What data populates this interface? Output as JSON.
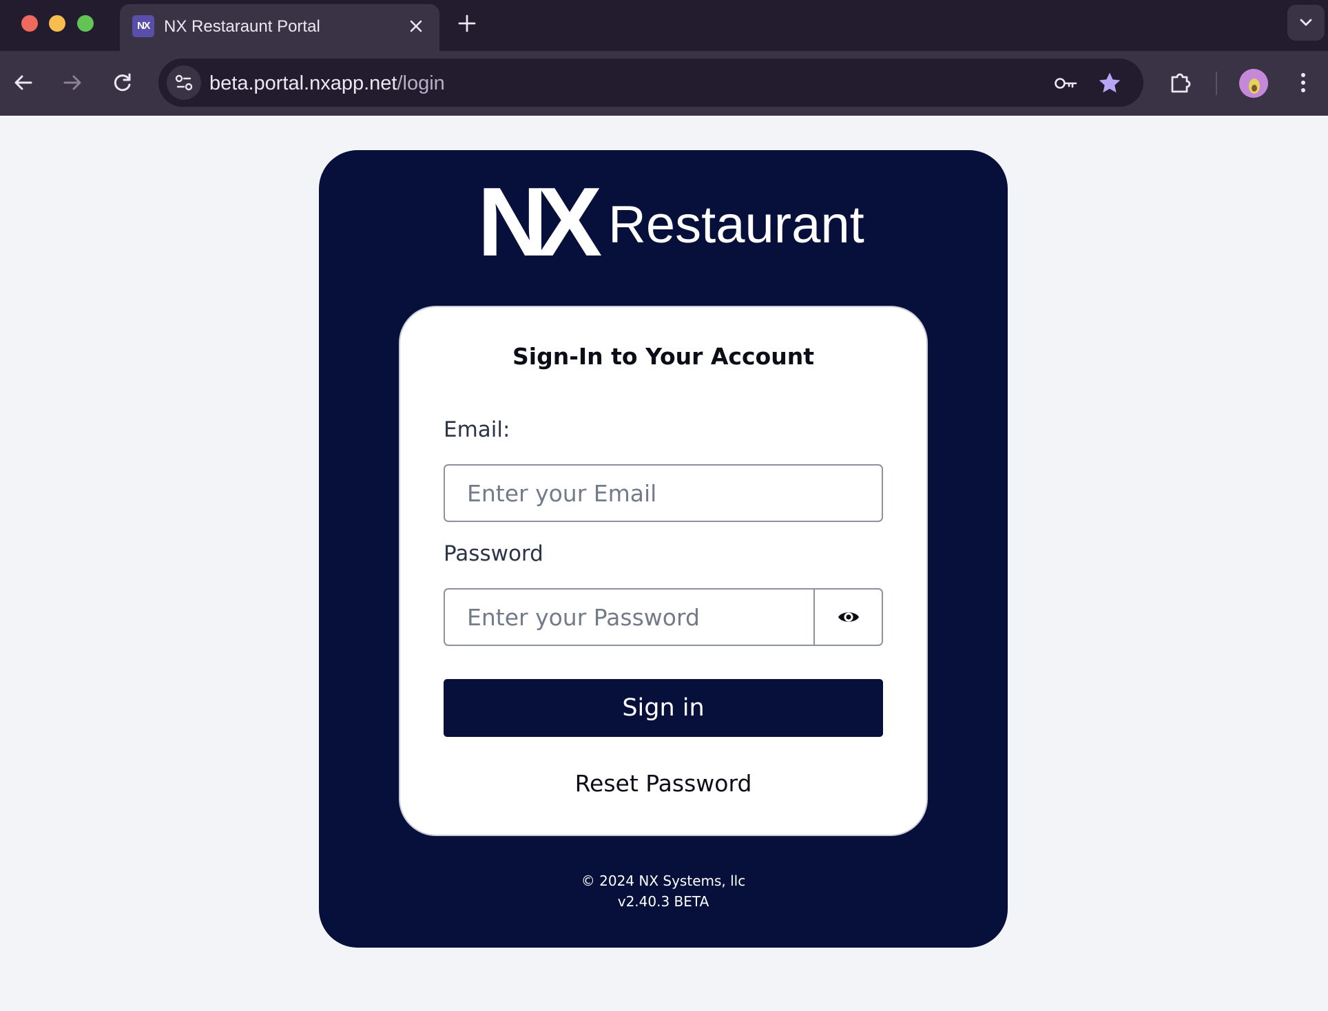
{
  "browser": {
    "tab": {
      "favicon_text": "NX",
      "title": "NX Restaraunt Portal"
    },
    "address_bar": {
      "url_host": "beta.portal.nxapp.net",
      "url_path": "/login"
    },
    "icons": {
      "back": "arrow-left-icon",
      "forward": "arrow-right-icon",
      "reload": "reload-icon",
      "site_info": "tune-icon",
      "password_manager": "key-icon",
      "bookmark": "star-icon",
      "extensions": "puzzle-icon",
      "menu": "three-dots-vertical-icon"
    },
    "colors": {
      "tabbar": "#231b2e",
      "toolbar": "#3a3245",
      "bookmark_star": "#b7a6f4"
    }
  },
  "brand": {
    "logo_mark": "NX",
    "logo_word": "Restaurant",
    "panel_color": "#06103a"
  },
  "login": {
    "title": "Sign-In to Your Account",
    "email_label": "Email:",
    "email_placeholder": "Enter your Email",
    "email_value": "",
    "password_label": "Password",
    "password_placeholder": "Enter your Password",
    "password_value": "",
    "toggle_icon": "eye-icon",
    "signin_label": "Sign in",
    "reset_label": "Reset Password"
  },
  "footer": {
    "copyright": "© 2024 NX Systems, llc",
    "version": "v2.40.3 BETA"
  }
}
